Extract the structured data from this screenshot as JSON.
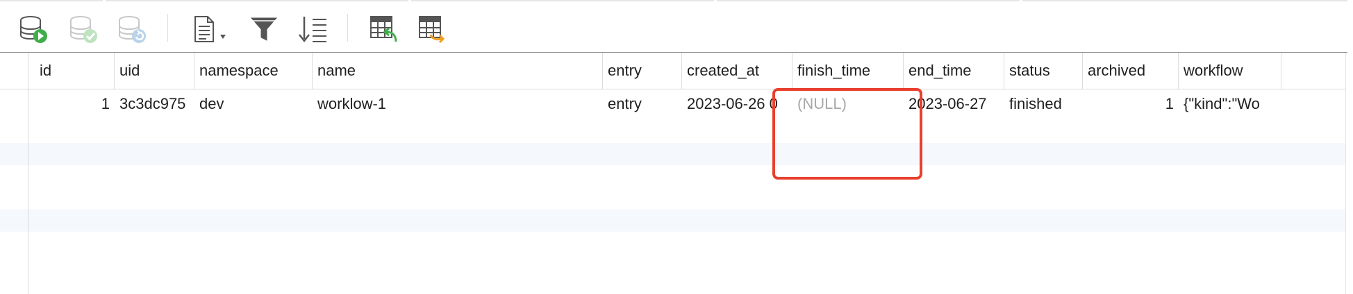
{
  "toolbar": {
    "buttons": [
      {
        "name": "begin-transaction",
        "icon": "database-play-icon",
        "enabled": true
      },
      {
        "name": "commit",
        "icon": "database-check-icon",
        "enabled": false
      },
      {
        "name": "rollback",
        "icon": "database-undo-icon",
        "enabled": false
      },
      {
        "name": "text",
        "icon": "document-dropdown-icon",
        "enabled": true
      },
      {
        "name": "filter",
        "icon": "filter-icon",
        "enabled": true
      },
      {
        "name": "sort",
        "icon": "sort-icon",
        "enabled": true
      },
      {
        "name": "import",
        "icon": "table-import-icon",
        "enabled": true
      },
      {
        "name": "export",
        "icon": "table-export-icon",
        "enabled": true
      }
    ]
  },
  "colors": {
    "accent_green": "#3fae49",
    "disabled": "#c8c8c8",
    "highlight": "#e8402d",
    "null_text": "#a8a8a8",
    "alt_row": "#f5f8fc"
  },
  "table": {
    "columns": [
      "id",
      "uid",
      "namespace",
      "name",
      "entry",
      "created_at",
      "finish_time",
      "end_time",
      "status",
      "archived",
      "workflow"
    ],
    "rows": [
      {
        "id": "1",
        "uid": "3c3dc975",
        "namespace": "dev",
        "name": "worklow-1",
        "entry": "entry",
        "created_at": "2023-06-26 0",
        "finish_time": "(NULL)",
        "end_time": "2023-06-27",
        "status": "finished",
        "archived": "1",
        "workflow": "{\"kind\":\"Wo"
      }
    ]
  }
}
